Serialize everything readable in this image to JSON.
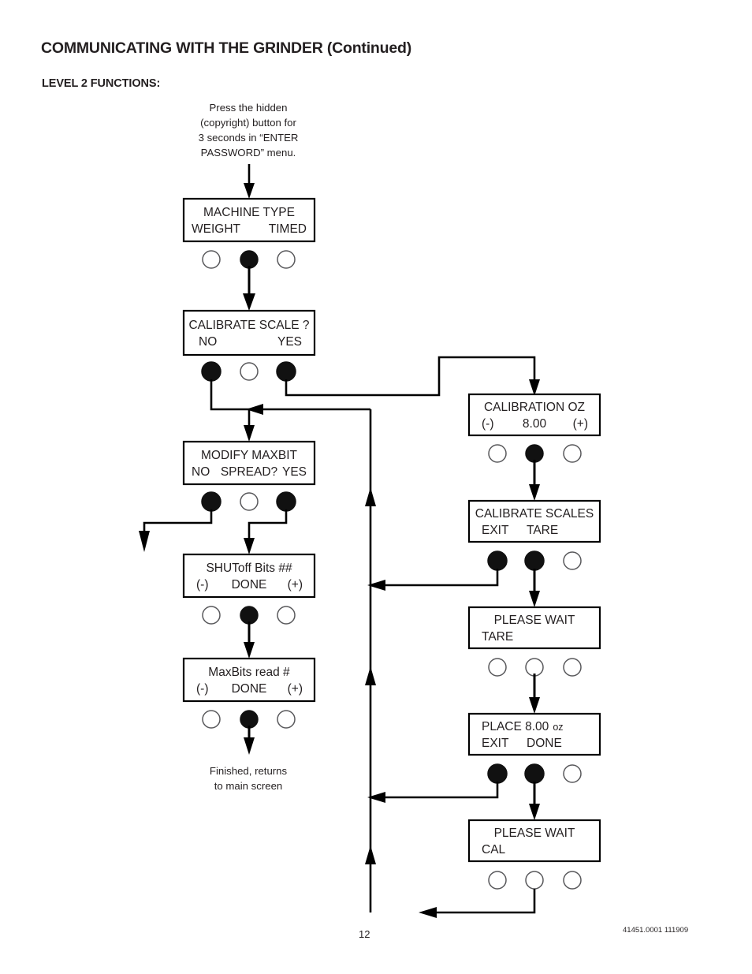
{
  "document": {
    "title": "COMMUNICATING WITH THE GRINDER (Continued)",
    "section_label": "LEVEL 2 FUNCTIONS:",
    "page_number": "12",
    "doc_code": "41451.0001  111909"
  },
  "notes": {
    "entry_note": [
      "Press the hidden",
      "(copyright) button for",
      "3 seconds in “ENTER",
      "PASSWORD” menu."
    ],
    "exit_note": [
      "Finished, returns",
      "to main screen"
    ]
  },
  "left_column": [
    {
      "id": "machine-type",
      "line1": "MACHINE TYPE",
      "line2_left": "WEIGHT",
      "line2_right": "TIMED",
      "buttons": [
        "open",
        "filled",
        "open"
      ]
    },
    {
      "id": "calibrate-scale",
      "line1": "CALIBRATE SCALE ?",
      "line2_left": "NO",
      "line2_right": "YES",
      "buttons": [
        "filled",
        "open",
        "filled"
      ]
    },
    {
      "id": "modify-maxbit",
      "line1": "MODIFY MAXBIT",
      "line2_left": "NO",
      "line2_mid": "SPREAD?",
      "line2_right": "YES",
      "buttons": [
        "filled",
        "open",
        "filled"
      ]
    },
    {
      "id": "shutoff-bits",
      "line1": "SHUToff Bits  ##",
      "line2_left": "(-)",
      "line2_mid": "DONE",
      "line2_right": "(+)",
      "buttons": [
        "open",
        "filled",
        "open"
      ]
    },
    {
      "id": "maxbits-read",
      "line1": "MaxBits read  #",
      "line2_left": "(-)",
      "line2_mid": "DONE",
      "line2_right": "(+)",
      "buttons": [
        "open",
        "filled",
        "open"
      ]
    }
  ],
  "right_column": [
    {
      "id": "calibration-oz",
      "line1": "CALIBRATION OZ",
      "line2_left": "(-)",
      "line2_mid": "8.00",
      "line2_right": "(+)",
      "buttons": [
        "open",
        "filled",
        "open"
      ]
    },
    {
      "id": "calibrate-scales",
      "line1": "CALIBRATE SCALES",
      "line2_left": "EXIT",
      "line2_mid": "TARE",
      "buttons": [
        "filled",
        "filled",
        "open"
      ]
    },
    {
      "id": "please-wait-tare",
      "line1": "PLEASE WAIT",
      "line2_left": "TARE",
      "buttons": [
        "open",
        "open",
        "open"
      ]
    },
    {
      "id": "place-8oz",
      "line1_main": "PLACE 8.00",
      "line1_unit": "oz",
      "line2_left": "EXIT",
      "line2_mid": "DONE",
      "buttons": [
        "filled",
        "filled",
        "open"
      ]
    },
    {
      "id": "please-wait-cal",
      "line1": "PLEASE WAIT",
      "line2_left": "CAL",
      "buttons": [
        "open",
        "open",
        "open"
      ]
    }
  ],
  "colors": {
    "ink": "#231f20",
    "line": "#000000",
    "filled_button": "#111111",
    "open_button_stroke": "#58585b"
  }
}
